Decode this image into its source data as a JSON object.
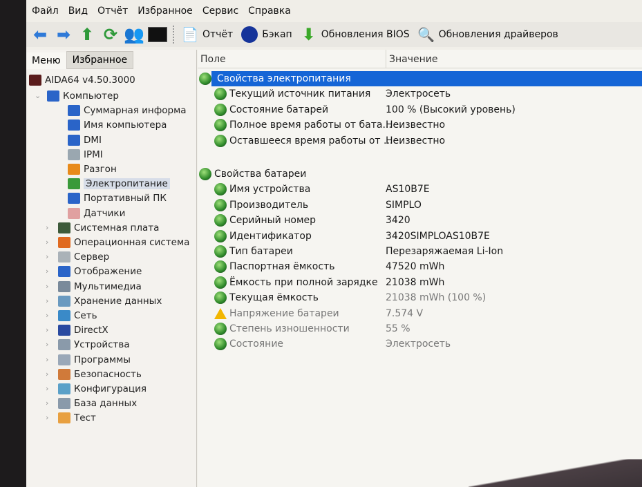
{
  "menu": [
    "Файл",
    "Вид",
    "Отчёт",
    "Избранное",
    "Сервис",
    "Справка"
  ],
  "toolbar": {
    "report": "Отчёт",
    "backup": "Бэкап",
    "bios": "Обновления BIOS",
    "drivers": "Обновления драйверов"
  },
  "tabs": {
    "menu": "Меню",
    "favorites": "Избранное"
  },
  "tree": [
    {
      "label": "AIDA64 v4.50.3000",
      "level": 0,
      "color": "#5a1c1c",
      "icon": "aida64-logo-icon"
    },
    {
      "label": "Компьютер",
      "level": 1,
      "color": "#2a64c8",
      "icon": "computer-icon",
      "expanded": true
    },
    {
      "label": "Суммарная информа",
      "level": 2,
      "color": "#2a64c8",
      "icon": "computer-icon"
    },
    {
      "label": "Имя компьютера",
      "level": 2,
      "color": "#2a64c8",
      "icon": "computer-icon"
    },
    {
      "label": "DMI",
      "level": 2,
      "color": "#2a64c8",
      "icon": "computer-icon"
    },
    {
      "label": "IPMI",
      "level": 2,
      "color": "#9aa7b0",
      "icon": "server-icon"
    },
    {
      "label": "Разгон",
      "level": 2,
      "color": "#e88a1a",
      "icon": "flame-icon"
    },
    {
      "label": "Электропитание",
      "level": 2,
      "color": "#3a9a3a",
      "icon": "power-icon",
      "selected": true
    },
    {
      "label": "Портативный ПК",
      "level": 2,
      "color": "#2a64c8",
      "icon": "laptop-icon"
    },
    {
      "label": "Датчики",
      "level": 2,
      "color": "#e0a0a0",
      "icon": "gauge-icon"
    },
    {
      "label": "Системная плата",
      "level": 1,
      "color": "#3d5a3a",
      "icon": "motherboard-icon",
      "collapsed": true
    },
    {
      "label": "Операционная система",
      "level": 1,
      "color": "#e06a20",
      "icon": "windows-icon",
      "collapsed": true
    },
    {
      "label": "Сервер",
      "level": 1,
      "color": "#aab2b8",
      "icon": "server-icon",
      "collapsed": true
    },
    {
      "label": "Отображение",
      "level": 1,
      "color": "#2a64c8",
      "icon": "display-icon",
      "collapsed": true
    },
    {
      "label": "Мультимедиа",
      "level": 1,
      "color": "#7a8a9a",
      "icon": "speaker-icon",
      "collapsed": true
    },
    {
      "label": "Хранение данных",
      "level": 1,
      "color": "#6a9ac0",
      "icon": "storage-icon",
      "collapsed": true
    },
    {
      "label": "Сеть",
      "level": 1,
      "color": "#3a8ac8",
      "icon": "network-icon",
      "collapsed": true
    },
    {
      "label": "DirectX",
      "level": 1,
      "color": "#2a4aa0",
      "icon": "directx-icon",
      "collapsed": true
    },
    {
      "label": "Устройства",
      "level": 1,
      "color": "#8a9aaa",
      "icon": "devices-icon",
      "collapsed": true
    },
    {
      "label": "Программы",
      "level": 1,
      "color": "#9aa8b8",
      "icon": "programs-icon",
      "collapsed": true
    },
    {
      "label": "Безопасность",
      "level": 1,
      "color": "#d07a3a",
      "icon": "security-icon",
      "collapsed": true
    },
    {
      "label": "Конфигурация",
      "level": 1,
      "color": "#5aa0c8",
      "icon": "config-icon",
      "collapsed": true
    },
    {
      "label": "База данных",
      "level": 1,
      "color": "#8a9aaa",
      "icon": "database-icon",
      "collapsed": true
    },
    {
      "label": "Тест",
      "level": 1,
      "color": "#e8a040",
      "icon": "test-icon",
      "collapsed": true
    }
  ],
  "columns": {
    "field": "Поле",
    "value": "Значение"
  },
  "rows": [
    {
      "field": "Свойства электропитания",
      "value": "",
      "type": "group",
      "highlighted": true
    },
    {
      "field": "Текущий источник питания",
      "value": "Электросеть",
      "type": "item"
    },
    {
      "field": "Состояние батарей",
      "value": "100 % (Высокий уровень)",
      "type": "item"
    },
    {
      "field": "Полное время работы от бата...",
      "value": "Неизвестно",
      "type": "item"
    },
    {
      "field": "Оставшееся время работы от ...",
      "value": "Неизвестно",
      "type": "item"
    },
    {
      "field": "",
      "value": "",
      "type": "blank"
    },
    {
      "field": "Свойства батареи",
      "value": "",
      "type": "group"
    },
    {
      "field": "Имя устройства",
      "value": "AS10B7E",
      "type": "item"
    },
    {
      "field": "Производитель",
      "value": "SIMPLO",
      "type": "item"
    },
    {
      "field": "Серийный номер",
      "value": "3420",
      "type": "item"
    },
    {
      "field": "Идентификатор",
      "value": "3420SIMPLOAS10B7E",
      "type": "item"
    },
    {
      "field": "Тип батареи",
      "value": "Перезаряжаемая Li-Ion",
      "type": "item"
    },
    {
      "field": "Паспортная ёмкость",
      "value": "47520 mWh",
      "type": "item"
    },
    {
      "field": "Ёмкость при полной зарядке",
      "value": "21038 mWh",
      "type": "item"
    },
    {
      "field": "Текущая ёмкость",
      "value": "21038 mWh  (100 %)",
      "type": "item"
    },
    {
      "field": "Напряжение батареи",
      "value": "7.574 V",
      "type": "item",
      "warning": true
    },
    {
      "field": "Степень изношенности",
      "value": "55 %",
      "type": "item"
    },
    {
      "field": "Состояние",
      "value": "Электросеть",
      "type": "item"
    }
  ]
}
